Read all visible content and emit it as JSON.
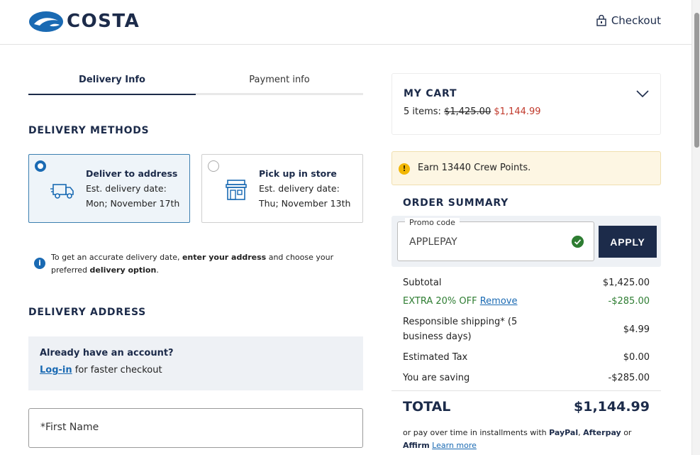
{
  "header": {
    "brand": "COSTA",
    "checkout_label": "Checkout"
  },
  "tabs": [
    {
      "label": "Delivery Info",
      "active": true
    },
    {
      "label": "Payment info",
      "active": false
    }
  ],
  "delivery_methods": {
    "title": "DELIVERY METHODS",
    "options": [
      {
        "title": "Deliver to address",
        "line1": "Est. delivery date:",
        "line2": "Mon; November 17th",
        "selected": true,
        "icon": "truck-icon"
      },
      {
        "title": "Pick up in store",
        "line1": "Est. delivery date:",
        "line2": "Thu; November 13th",
        "selected": false,
        "icon": "store-icon"
      }
    ]
  },
  "info_note": {
    "prefix": "To get an accurate delivery date, ",
    "bold1": "enter your address",
    "middle": " and choose your preferred ",
    "bold2": "delivery option",
    "suffix": "."
  },
  "delivery_address": {
    "title": "DELIVERY ADDRESS",
    "account_title": "Already have an account?",
    "login_label": "Log-in",
    "login_suffix": " for faster checkout",
    "first_name_placeholder": "*First Name"
  },
  "cart": {
    "title": "MY CART",
    "items_label": "5 items: ",
    "original_price": "$1,425.00",
    "sale_price": "$1,144.99"
  },
  "points": {
    "text": "Earn 13440 Crew Points."
  },
  "order_summary": {
    "title": "ORDER SUMMARY",
    "promo_label": "Promo code",
    "promo_value": "APPLEPAY",
    "apply_label": "APPLY",
    "subtotal_label": "Subtotal",
    "subtotal_value": "$1,425.00",
    "discount_label": "EXTRA 20% OFF",
    "discount_remove": "Remove",
    "discount_value": "-$285.00",
    "shipping_label": "Responsible shipping* (5 business days)",
    "shipping_value": "$4.99",
    "tax_label": "Estimated Tax",
    "tax_value": "$0.00",
    "saving_label": "You are saving",
    "saving_value": "-$285.00",
    "total_label": "TOTAL",
    "total_value": "$1,144.99",
    "installments_prefix": "or pay over time in installments with ",
    "paypal": "PayPal",
    "sep1": ", ",
    "afterpay": "Afterpay",
    "sep2": " or ",
    "affirm": "Affirm",
    "learn_more": "Learn more"
  },
  "colors": {
    "brand_navy": "#1c2b4a",
    "link_blue": "#1a6ab3",
    "discount_green": "#2e7d32",
    "saving_red": "#c0392b"
  }
}
